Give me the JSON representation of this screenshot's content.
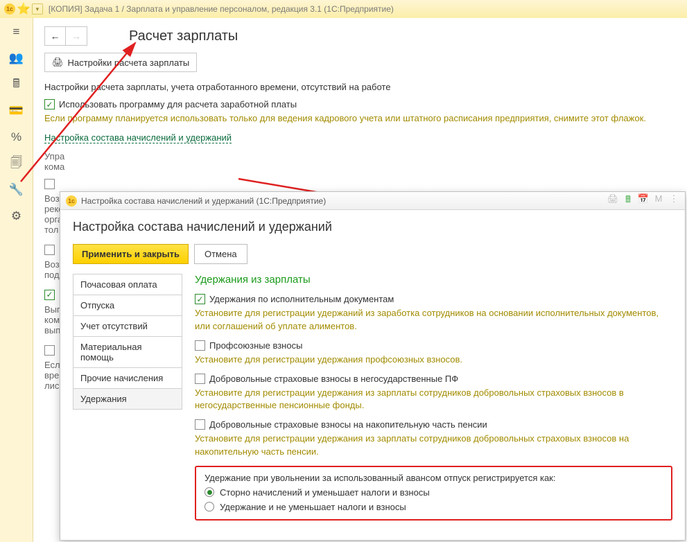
{
  "window": {
    "title": "[КОПИЯ] Задача 1 / Зарплата и управление персоналом, редакция 3.1  (1С:Предприятие)"
  },
  "page": {
    "title": "Расчет зарплаты",
    "settings_btn": "Настройки расчета зарплаты",
    "descr": "Настройки расчета зарплаты, учета отработанного времени, отсутствий на работе",
    "chk1": "Использовать программу для расчета заработной платы",
    "hint1": "Если программу планируется использовать только для ведения кадрового учета или штатного расписания предприятия, снимите этот флажок.",
    "link1": "Настройка состава начислений и удержаний",
    "cut1": "Упра",
    "cut2": "кома",
    "cut3": "Воз",
    "cut4": "реко",
    "cut5": "орга",
    "cut6": "тол",
    "cut7": "Воз",
    "cut8": "под",
    "cut9": "Вып",
    "cut10": "ком",
    "cut11": "вып",
    "cut12": "Есл",
    "cut13": "вре",
    "cut14": "лис"
  },
  "dialog": {
    "title": "Настройка состава начислений и удержаний  (1С:Предприятие)",
    "h1": "Настройка состава начислений и удержаний",
    "apply": "Применить и закрыть",
    "cancel": "Отмена",
    "tabs": [
      "Почасовая оплата",
      "Отпуска",
      "Учет отсутствий",
      "Материальная помощь",
      "Прочие начисления",
      "Удержания"
    ],
    "section": "Удержания из зарплаты",
    "opt1": "Удержания по исполнительным документам",
    "opt1_hint": "Установите для регистрации удержаний из заработка сотрудников на основании исполнительных документов, или соглашений об уплате алиментов.",
    "opt2": "Профсоюзные взносы",
    "opt2_hint": "Установите для регистрации удержания профсоюзных взносов.",
    "opt3": "Добровольные страховые взносы в негосударственные ПФ",
    "opt3_hint": "Установите для регистрации удержания из зарплаты сотрудников добровольных страховых взносов в негосударственные пенсионные фонды.",
    "opt4": "Добровольные страховые взносы на накопительную часть пенсии",
    "opt4_hint": "Установите для регистрации удержания из зарплаты сотрудников добровольных страховых взносов на накопительную часть пенсии.",
    "radio_title": "Удержание при увольнении за использованный авансом отпуск регистрируется как:",
    "radio1": "Сторно начислений и уменьшает налоги и взносы",
    "radio2": "Удержание и не уменьшает налоги и взносы"
  }
}
